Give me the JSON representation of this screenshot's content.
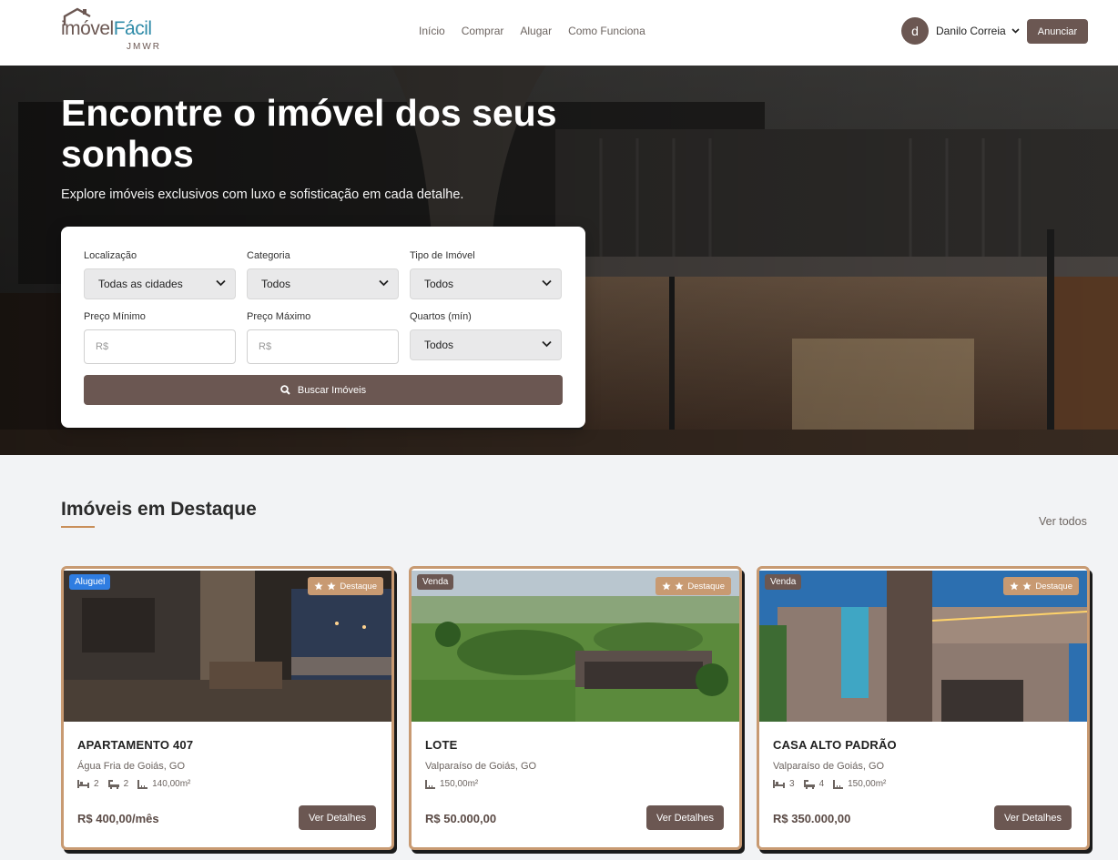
{
  "brand": {
    "logo_main_1": "imóvel",
    "logo_main_2": "Fácil",
    "logo_sub": "JMWR"
  },
  "nav": [
    "Início",
    "Comprar",
    "Alugar",
    "Como Funciona"
  ],
  "user": {
    "initial": "d",
    "name": "Danilo Correia"
  },
  "header": {
    "announce_label": "Anunciar"
  },
  "hero": {
    "title": "Encontre o imóvel dos seus sonhos",
    "subtitle": "Explore imóveis exclusivos com luxo e sofisticação em cada detalhe."
  },
  "search": {
    "location_label": "Localização",
    "location_value": "Todas as cidades",
    "category_label": "Categoria",
    "category_value": "Todos",
    "type_label": "Tipo de Imóvel",
    "type_value": "Todos",
    "min_price_label": "Preço Mínimo",
    "min_price_placeholder": "R$",
    "max_price_label": "Preço Máximo",
    "max_price_placeholder": "R$",
    "rooms_label": "Quartos (mín)",
    "rooms_value": "Todos",
    "submit_label": "Buscar Imóveis"
  },
  "featured": {
    "title": "Imóveis em Destaque",
    "see_all": "Ver todos",
    "badge_label": "Destaque",
    "details_label": "Ver Detalhes",
    "cards": [
      {
        "type": "Aluguel",
        "type_color": "#2f7de1",
        "title": "APARTAMENTO 407",
        "location": "Água Fria de Goiás, GO",
        "beds": "2",
        "baths": "2",
        "area": "140,00m²",
        "price": "R$ 400,00/mês"
      },
      {
        "type": "Venda",
        "type_color": "#6b5752",
        "title": "LOTE",
        "location": "Valparaíso de Goiás, GO",
        "area": "150,00m²",
        "price": "R$ 50.000,00"
      },
      {
        "type": "Venda",
        "type_color": "#6b5752",
        "title": "CASA ALTO PADRÃO",
        "location": "Valparaíso de Goiás, GO",
        "beds": "3",
        "baths": "4",
        "area": "150,00m²",
        "price": "R$ 350.000,00"
      }
    ]
  },
  "colors": {
    "brand_brown": "#6b5752",
    "accent_tan": "#c89a72",
    "logo_blue": "#2f8ba8",
    "rent_blue": "#2f7de1"
  }
}
